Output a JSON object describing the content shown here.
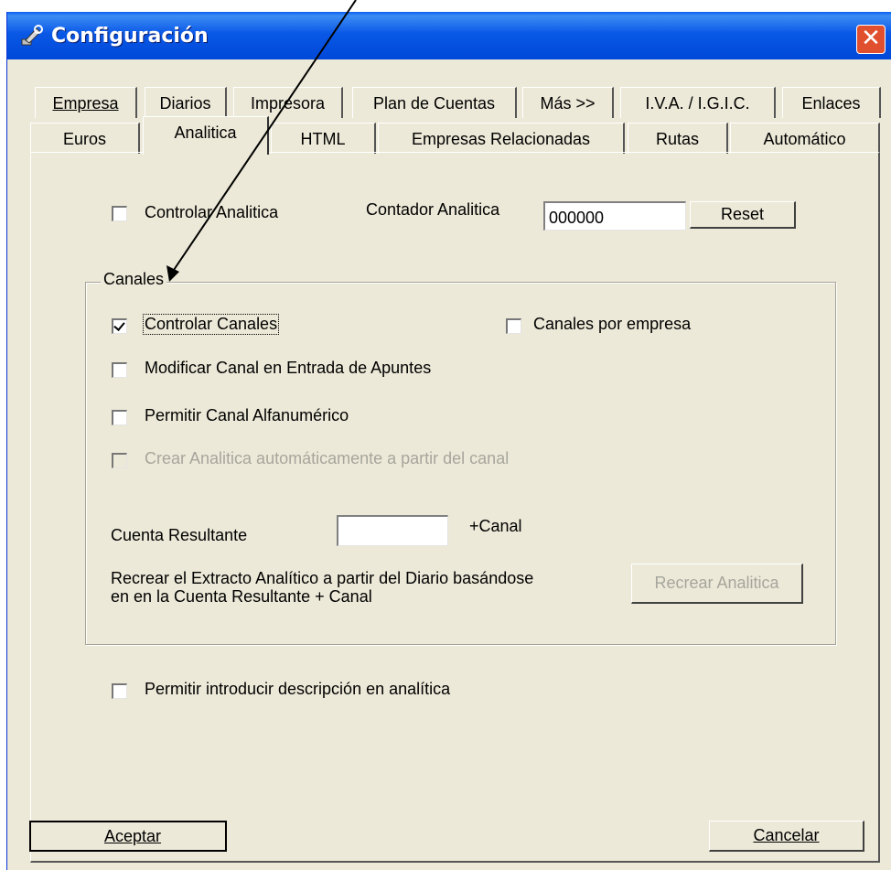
{
  "window": {
    "title": "Configuración",
    "close_glyph": "✕"
  },
  "tabs": {
    "row1": [
      "Empresa",
      "Diarios",
      "Impresora",
      "Plan de Cuentas",
      "Más >>",
      "I.V.A. / I.G.I.C.",
      "Enlaces"
    ],
    "row2": [
      "Euros",
      "Analitica",
      "HTML",
      "Empresas Relacionadas",
      "Rutas",
      "Automático"
    ],
    "active": "Analitica"
  },
  "analitica": {
    "controlar_analitica": {
      "label": "Controlar Analitica",
      "checked": false
    },
    "contador_label": "Contador Analitica",
    "contador_value": "000000",
    "reset_label": "Reset"
  },
  "canales": {
    "group_title": "Canales",
    "controlar_canales": {
      "label": "Controlar Canales",
      "checked": true
    },
    "canales_por_empresa": {
      "label": "Canales por empresa",
      "checked": false
    },
    "modificar_canal": {
      "label": "Modificar Canal en Entrada de Apuntes",
      "checked": false
    },
    "permitir_alfanumerico": {
      "label": "Permitir Canal Alfanumérico",
      "checked": false
    },
    "crear_analitica": {
      "label": "Crear Analitica automáticamente a partir del canal",
      "checked": false,
      "disabled": true
    },
    "cuenta_resultante_label": "Cuenta Resultante",
    "cuenta_resultante_value": "",
    "canal_suffix": "+Canal",
    "recrear_text_1": "Recrear el Extracto Analítico a partir del Diario basándose",
    "recrear_text_2": "en en la Cuenta Resultante + Canal",
    "recrear_button": "Recrear Analitica"
  },
  "permitir_descripcion": {
    "label": "Permitir introducir descripción en analítica",
    "checked": false
  },
  "footer": {
    "accept": "Aceptar",
    "cancel": "Cancelar"
  }
}
